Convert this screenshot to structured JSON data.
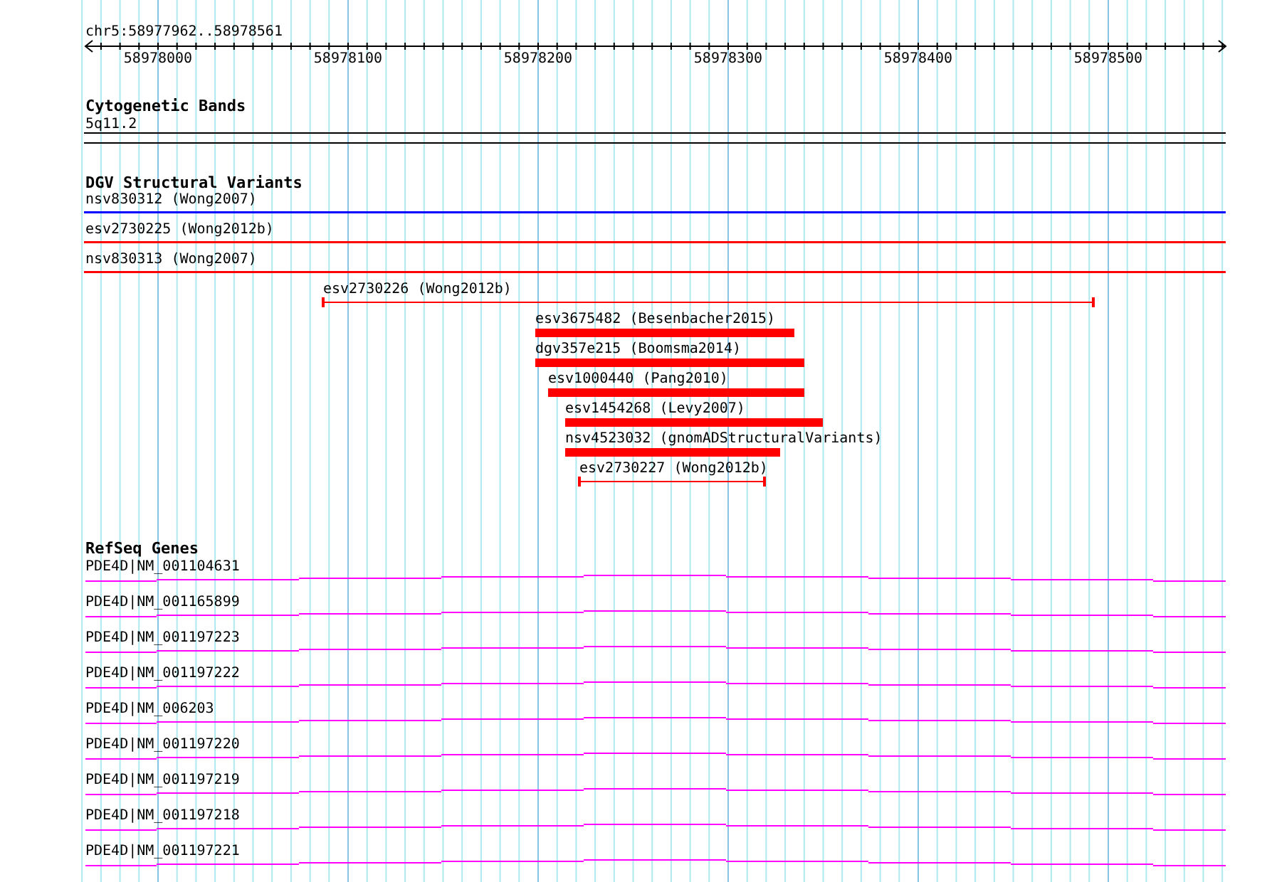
{
  "ruler": {
    "label": "chr5:58977962..58978561",
    "ticks": [
      "58978000",
      "58978100",
      "58978200",
      "58978300",
      "58978400",
      "58978500"
    ]
  },
  "cytogenetic_bands": {
    "title": "Cytogenetic Bands",
    "band": "5q11.2"
  },
  "dgv": {
    "title": "DGV Structural Variants",
    "variants": [
      {
        "label": "nsv830312 (Wong2007)",
        "kind": "line",
        "color": "#0000ff"
      },
      {
        "label": "esv2730225 (Wong2012b)",
        "kind": "line",
        "color": "#ff0000"
      },
      {
        "label": "nsv830313 (Wong2007)",
        "kind": "line",
        "color": "#ff0000"
      },
      {
        "label": "esv2730226 (Wong2012b)",
        "kind": "span",
        "color": "#ff0000"
      },
      {
        "label": "esv3675482 (Besenbacher2015)",
        "kind": "bar",
        "color": "#ff0000"
      },
      {
        "label": "dgv357e215 (Boomsma2014)",
        "kind": "bar",
        "color": "#ff0000"
      },
      {
        "label": "esv1000440 (Pang2010)",
        "kind": "bar",
        "color": "#ff0000"
      },
      {
        "label": "esv1454268 (Levy2007)",
        "kind": "bar",
        "color": "#ff0000"
      },
      {
        "label": "nsv4523032 (gnomADStructuralVariants)",
        "kind": "bar",
        "color": "#ff0000"
      },
      {
        "label": "esv2730227 (Wong2012b)",
        "kind": "span",
        "color": "#ff0000"
      }
    ]
  },
  "refseq_genes": {
    "title": "RefSeq Genes",
    "transcripts": [
      {
        "label": "PDE4D|NM_001104631"
      },
      {
        "label": "PDE4D|NM_001165899"
      },
      {
        "label": "PDE4D|NM_001197223"
      },
      {
        "label": "PDE4D|NM_001197222"
      },
      {
        "label": "PDE4D|NM_006203"
      },
      {
        "label": "PDE4D|NM_001197220"
      },
      {
        "label": "PDE4D|NM_001197219"
      },
      {
        "label": "PDE4D|NM_001197218"
      },
      {
        "label": "PDE4D|NM_001197221"
      }
    ]
  }
}
